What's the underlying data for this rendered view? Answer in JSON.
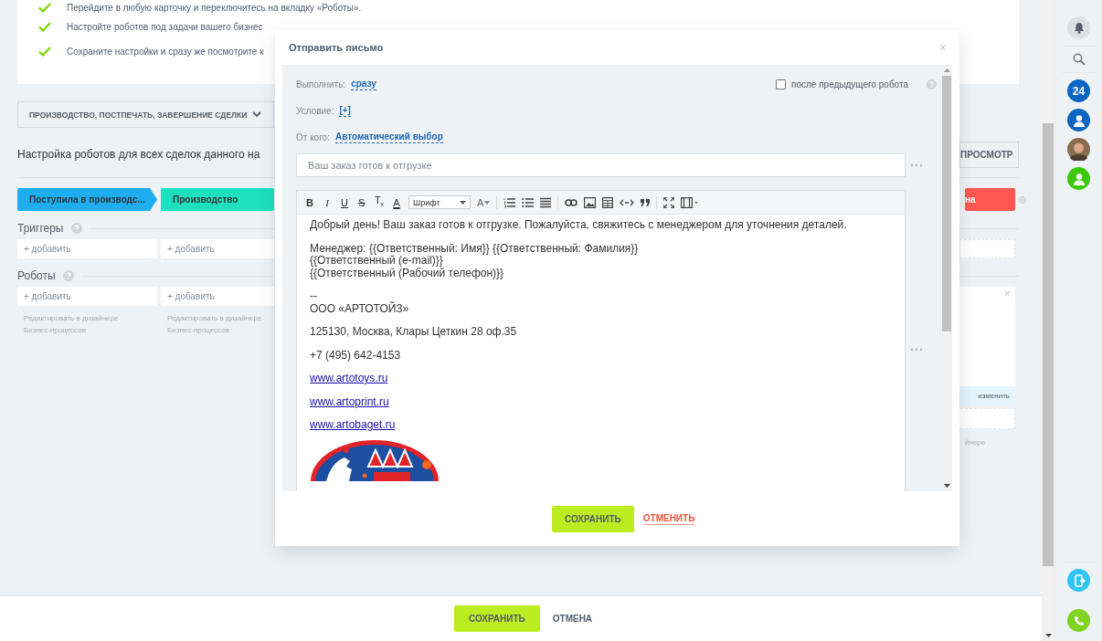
{
  "checklist": [
    "Перейдите в любую карточку и переключитесь на вкладку «Роботы».",
    "Настройте роботов под задачи вашего бизнес",
    "Сохраните настройки и сразу же посмотрите к"
  ],
  "pipeline_selector": "ПРОИЗВОДСТВО, ПОСТПЕЧАТЬ, ЗАВЕРШЕНИЕ СДЕЛКИ",
  "heading": "Настройка роботов для всех сделок данного на",
  "preview_button": "ПРОСМОТР",
  "stages": [
    {
      "label": "Поступила в производс...",
      "color": "#1eaef0"
    },
    {
      "label": "Производство",
      "color": "#1ee0be"
    }
  ],
  "last_stage": {
    "label": "на",
    "color": "#ff5752"
  },
  "triggers": {
    "title": "Триггеры",
    "add_buttons": [
      "+ добавить",
      "+ добавить"
    ]
  },
  "robots": {
    "title": "Роботы",
    "columns": [
      {
        "add": "+ добавить",
        "hint": "Редактировать в дизайнере Бизнес-процессов"
      },
      {
        "add": "+ добавить",
        "hint": "Редактировать в дизайнере Бизнес-процессов"
      }
    ],
    "card_action": "изменить",
    "right_hint": "йнере"
  },
  "footer": {
    "save": "СОХРАНИТЬ",
    "cancel": "ОТМЕНА"
  },
  "rail": {
    "counter": "24"
  },
  "dialog": {
    "title": "Отправить письмо",
    "close": "×",
    "run_label": "Выполнить:",
    "run_value": "сразу",
    "after_previous": {
      "label": "после предыдущего робота",
      "checked": false
    },
    "condition_label": "Условие:",
    "condition_value": "[+]",
    "from_label": "От кого:",
    "from_value": "Автоматический выбор",
    "subject": "Ваш заказ готов к отгрузке",
    "format_buttons": [
      {
        "label": "B",
        "kind": "bold"
      },
      {
        "label": "I",
        "kind": "italic"
      },
      {
        "label": "U",
        "kind": "underline"
      },
      {
        "label": "S",
        "kind": "strike"
      },
      {
        "label": "T$_{x}$",
        "kind": "clear"
      },
      {
        "label": "A",
        "kind": "color"
      }
    ],
    "font_select": "Шрифт",
    "size_button": "A",
    "body": [
      {
        "kind": "para",
        "lines": [
          "Добрый день! Ваш заказ готов к отгрузке. Пожалуйста, свяжитесь с менеджером для уточнения деталей."
        ]
      },
      {
        "kind": "para",
        "lines": [
          "Менеджер: {{Ответственный: Имя}} {{Ответственный: Фамилия}}",
          "{{Ответственный (e-mail)}}",
          "{{Ответственный (Рабочий телефон)}}"
        ]
      },
      {
        "kind": "para",
        "lines": [
          "--",
          "ООО «АРТОТОЙЗ»"
        ]
      },
      {
        "kind": "para",
        "lines": [
          "125130, Москва, Клары Цеткин 28 оф.35"
        ]
      },
      {
        "kind": "para",
        "lines": [
          "+7 (495) 642-4153"
        ]
      },
      {
        "kind": "link",
        "text": "www.artotoys.ru"
      },
      {
        "kind": "link",
        "text": "www.artoprint.ru"
      },
      {
        "kind": "link",
        "text": "www.artobaget.ru"
      },
      {
        "kind": "picture"
      }
    ],
    "save": "СОХРАНИТЬ",
    "cancel": "ОТМЕНИТЬ"
  }
}
